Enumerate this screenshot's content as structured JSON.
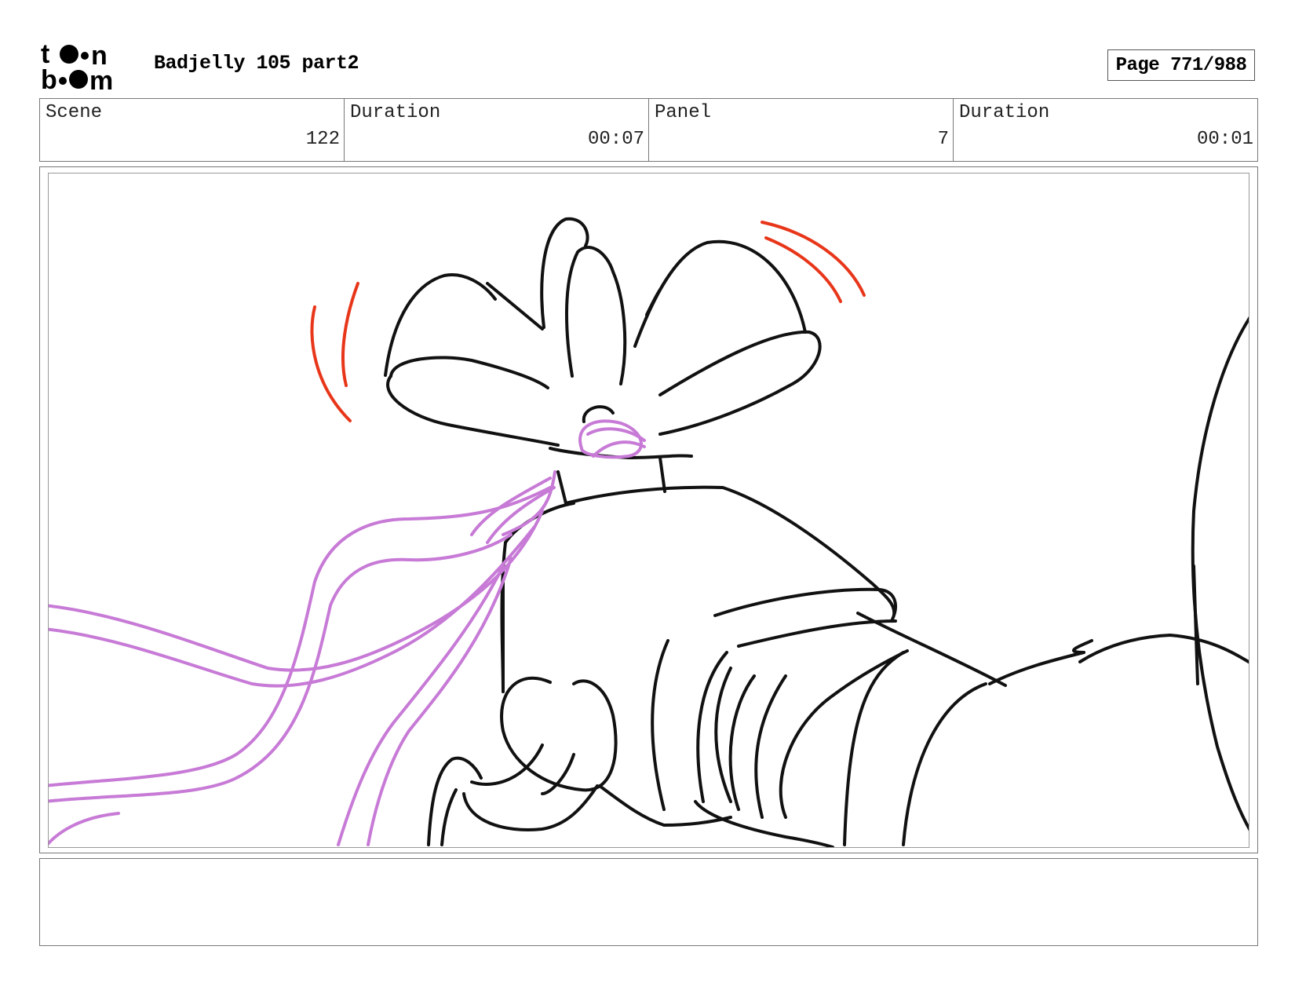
{
  "header": {
    "logo_text": "toon boom",
    "project_title": "Badjelly 105 part2",
    "page_label": "Page 771/988"
  },
  "info": {
    "scene_label": "Scene",
    "scene_value": "122",
    "scene_duration_label": "Duration",
    "scene_duration_value": "00:07",
    "panel_label": "Panel",
    "panel_value": "7",
    "panel_duration_label": "Duration",
    "panel_duration_value": "00:01"
  },
  "notes": {
    "text": ""
  },
  "colors": {
    "line": "#111111",
    "ribbon": "#c77ad6",
    "motion": "#e8361a"
  }
}
